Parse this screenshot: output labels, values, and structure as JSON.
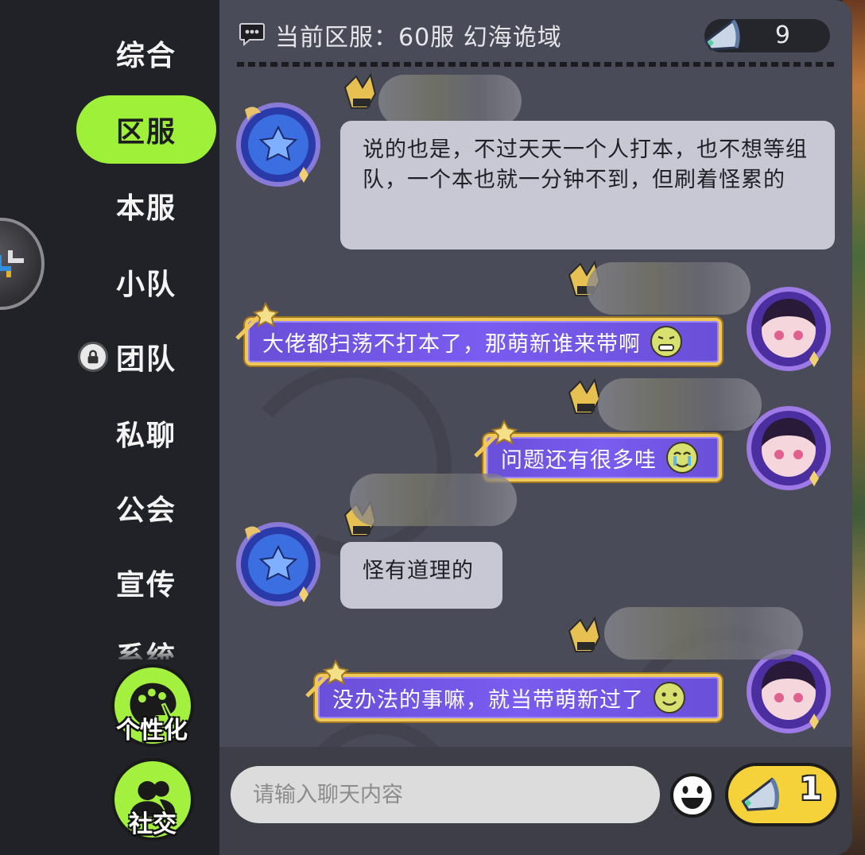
{
  "sidebar": {
    "tabs": [
      {
        "label": "综合",
        "active": false
      },
      {
        "label": "区服",
        "active": true
      },
      {
        "label": "本服",
        "active": false
      },
      {
        "label": "小队",
        "active": false
      },
      {
        "label": "团队",
        "active": false,
        "locked": true
      },
      {
        "label": "私聊",
        "active": false
      },
      {
        "label": "公会",
        "active": false
      },
      {
        "label": "宣传",
        "active": false
      },
      {
        "label": "系统",
        "active": false
      }
    ],
    "personalize_label": "个性化",
    "social_label": "社交"
  },
  "header": {
    "server_text": "当前区服：60服 幻海诡域",
    "horn_count": "9"
  },
  "messages": [
    {
      "side": "left",
      "style": "plain",
      "text": "说的也是，不过天天一个人打本，也不想等组队，一个本也就一分钟不到，但刷着怪累的"
    },
    {
      "side": "right",
      "style": "fancy",
      "text": "大佬都扫荡不打本了，那萌新谁来带啊",
      "emoji": "grimace-emoji"
    },
    {
      "side": "right",
      "style": "fancy",
      "text": "问题还有很多哇",
      "emoji": "crying-emoji"
    },
    {
      "side": "left",
      "style": "plain",
      "text": "怪有道理的"
    },
    {
      "side": "right",
      "style": "fancy",
      "text": "没办法的事嘛，就当带萌新过了",
      "emoji": "sweat-smile-emoji"
    }
  ],
  "input": {
    "placeholder": "请输入聊天内容",
    "send_horn_count": "1"
  },
  "colors": {
    "active_tab": "#9ef039",
    "panel_bg": "#4a4b58",
    "plain_bubble": "#c7c8d3",
    "fancy_bubble": "#7a5cf0",
    "fancy_border": "#f0c85a",
    "send_button": "#f6d23a"
  }
}
